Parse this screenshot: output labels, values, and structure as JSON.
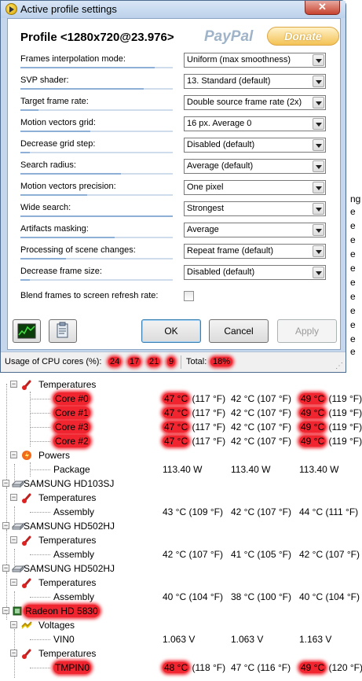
{
  "window": {
    "title": "Active profile settings",
    "close_label": "✕"
  },
  "profile": {
    "title": "Profile <1280x720@23.976>",
    "paypal": "PayPal",
    "donate": "Donate"
  },
  "settings": [
    {
      "label": "Frames interpolation mode:",
      "value": "Uniform (max smoothness)",
      "level": 0.88
    },
    {
      "label": "SVP shader:",
      "value": "13. Standard (default)",
      "level": 0.81
    },
    {
      "label": "Target frame rate:",
      "value": "Double source frame rate (2x)",
      "level": 0.12
    },
    {
      "label": "Motion vectors grid:",
      "value": "16 px. Average 0",
      "level": 0.46
    },
    {
      "label": "Decrease grid step:",
      "value": "Disabled (default)",
      "level": 0.06
    },
    {
      "label": "Search radius:",
      "value": "Average (default)",
      "level": 0.66
    },
    {
      "label": "Motion vectors precision:",
      "value": "One pixel",
      "level": 0.44
    },
    {
      "label": "Wide search:",
      "value": "Strongest",
      "level": 1.0
    },
    {
      "label": "Artifacts masking:",
      "value": "Average",
      "level": 0.62
    },
    {
      "label": "Processing of scene changes:",
      "value": "Repeat frame (default)",
      "level": 0.3
    },
    {
      "label": "Decrease frame size:",
      "value": "Disabled (default)",
      "level": 0.06
    }
  ],
  "blend": {
    "label": "Blend frames to screen refresh rate:",
    "checked": false
  },
  "buttons": {
    "ok": "OK",
    "cancel": "Cancel",
    "apply": "Apply"
  },
  "status": {
    "cpu_label": "Usage of CPU cores (%):",
    "cores": [
      "24",
      "17",
      "21",
      "9"
    ],
    "total_label": "Total:",
    "total": "18%"
  },
  "behind_right_edge": [
    "ng",
    "e",
    "e",
    "e",
    "e",
    "e",
    "e",
    "e",
    "e",
    "e",
    "e",
    "e"
  ],
  "monitor": {
    "colors": {
      "highlight": "#f0252f",
      "chip": "#2d7a2d"
    },
    "rows": [
      {
        "indent": 1,
        "expander": "−",
        "icon": "thermometer-icon",
        "label": "Temperatures",
        "c1": "",
        "c2": "",
        "c3": ""
      },
      {
        "indent": 3,
        "expander": "",
        "icon": "",
        "label": "Core #0",
        "c1": "47 °C  (117 °F)",
        "c2": "42 °C  (107 °F)",
        "c3": "49 °C  (119 °F)",
        "hl": true
      },
      {
        "indent": 3,
        "expander": "",
        "icon": "",
        "label": "Core #1",
        "c1": "47 °C  (117 °F)",
        "c2": "42 °C  (107 °F)",
        "c3": "49 °C  (119 °F)",
        "hl": true
      },
      {
        "indent": 3,
        "expander": "",
        "icon": "",
        "label": "Core #3",
        "c1": "47 °C  (117 °F)",
        "c2": "42 °C  (107 °F)",
        "c3": "49 °C  (119 °F)",
        "hl": true
      },
      {
        "indent": 3,
        "expander": "",
        "icon": "",
        "label": "Core #2",
        "c1": "47 °C  (117 °F)",
        "c2": "42 °C  (107 °F)",
        "c3": "49 °C  (119 °F)",
        "hl": true
      },
      {
        "indent": 1,
        "expander": "−",
        "icon": "power-icon",
        "label": "Powers",
        "c1": "",
        "c2": "",
        "c3": ""
      },
      {
        "indent": 3,
        "expander": "",
        "icon": "",
        "label": "Package",
        "c1": "113.40 W",
        "c2": "113.40 W",
        "c3": "113.40 W"
      },
      {
        "indent": 0,
        "expander": "−",
        "icon": "disk-icon",
        "label": "SAMSUNG HD103SJ",
        "c1": "",
        "c2": "",
        "c3": ""
      },
      {
        "indent": 1,
        "expander": "−",
        "icon": "thermometer-icon",
        "label": "Temperatures",
        "c1": "",
        "c2": "",
        "c3": ""
      },
      {
        "indent": 3,
        "expander": "",
        "icon": "",
        "label": "Assembly",
        "c1": "43 °C  (109 °F)",
        "c2": "42 °C  (107 °F)",
        "c3": "44 °C  (111 °F)"
      },
      {
        "indent": 0,
        "expander": "−",
        "icon": "disk-icon",
        "label": "SAMSUNG HD502HJ",
        "c1": "",
        "c2": "",
        "c3": ""
      },
      {
        "indent": 1,
        "expander": "−",
        "icon": "thermometer-icon",
        "label": "Temperatures",
        "c1": "",
        "c2": "",
        "c3": ""
      },
      {
        "indent": 3,
        "expander": "",
        "icon": "",
        "label": "Assembly",
        "c1": "42 °C  (107 °F)",
        "c2": "41 °C  (105 °F)",
        "c3": "42 °C  (107 °F)"
      },
      {
        "indent": 0,
        "expander": "−",
        "icon": "disk-icon",
        "label": "SAMSUNG HD502HJ",
        "c1": "",
        "c2": "",
        "c3": ""
      },
      {
        "indent": 1,
        "expander": "−",
        "icon": "thermometer-icon",
        "label": "Temperatures",
        "c1": "",
        "c2": "",
        "c3": ""
      },
      {
        "indent": 3,
        "expander": "",
        "icon": "",
        "label": "Assembly",
        "c1": "40 °C  (104 °F)",
        "c2": "38 °C  (100 °F)",
        "c3": "40 °C  (104 °F)"
      },
      {
        "indent": 0,
        "expander": "−",
        "icon": "gpu-chip-icon",
        "label": "Radeon HD 5830",
        "c1": "",
        "c2": "",
        "c3": "",
        "hlLabel": true
      },
      {
        "indent": 1,
        "expander": "−",
        "icon": "voltage-icon",
        "label": "Voltages",
        "c1": "",
        "c2": "",
        "c3": ""
      },
      {
        "indent": 3,
        "expander": "",
        "icon": "",
        "label": "VIN0",
        "c1": "1.063 V",
        "c2": "1.063 V",
        "c3": "1.163 V"
      },
      {
        "indent": 1,
        "expander": "−",
        "icon": "thermometer-icon",
        "label": "Temperatures",
        "c1": "",
        "c2": "",
        "c3": ""
      },
      {
        "indent": 3,
        "expander": "",
        "icon": "",
        "label": "TMPIN0",
        "c1": "48 °C  (118 °F)",
        "c2": "47 °C  (116 °F)",
        "c3": "49 °C  (120 °F)",
        "hl": true
      }
    ]
  }
}
